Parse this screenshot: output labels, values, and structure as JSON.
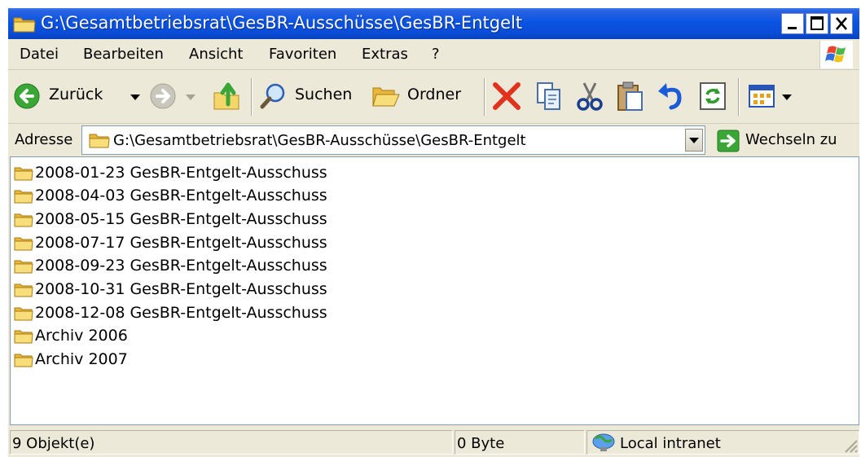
{
  "window": {
    "title": "G:\\Gesamtbetriebsrat\\GesBR-Ausschüsse\\GesBR-Entgelt",
    "controls": [
      "minimize-icon",
      "maximize-icon",
      "close-icon"
    ]
  },
  "menu": {
    "items": [
      "Datei",
      "Bearbeiten",
      "Ansicht",
      "Favoriten",
      "Extras",
      "?"
    ]
  },
  "toolbar": {
    "back_label": "Zurück",
    "search_label": "Suchen",
    "folders_label": "Ordner",
    "icons": [
      "back-arrow-icon",
      "forward-arrow-icon",
      "folder-up-icon",
      "search-icon",
      "folders-icon",
      "delete-icon",
      "copy-icon",
      "cut-icon",
      "paste-icon",
      "undo-icon",
      "refresh-icon",
      "views-icon"
    ]
  },
  "address": {
    "label": "Adresse",
    "value": "G:\\Gesamtbetriebsrat\\GesBR-Ausschüsse\\GesBR-Entgelt",
    "go_label": "Wechseln zu"
  },
  "files": [
    {
      "name": "2008-01-23 GesBR-Entgelt-Ausschuss"
    },
    {
      "name": "2008-04-03 GesBR-Entgelt-Ausschuss"
    },
    {
      "name": "2008-05-15 GesBR-Entgelt-Ausschuss"
    },
    {
      "name": "2008-07-17 GesBR-Entgelt-Ausschuss"
    },
    {
      "name": "2008-09-23 GesBR-Entgelt-Ausschuss"
    },
    {
      "name": "2008-10-31 GesBR-Entgelt-Ausschuss"
    },
    {
      "name": "2008-12-08 GesBR-Entgelt-Ausschuss"
    },
    {
      "name": "Archiv 2006"
    },
    {
      "name": "Archiv 2007"
    }
  ],
  "status": {
    "count": "9 Objekt(e)",
    "size": "0 Byte",
    "zone": "Local intranet"
  },
  "colors": {
    "titlebar": "#0a54e3",
    "chrome": "#ece9d8",
    "folder": "#f5d66b",
    "delete": "#e0321d",
    "go": "#3aa635"
  }
}
